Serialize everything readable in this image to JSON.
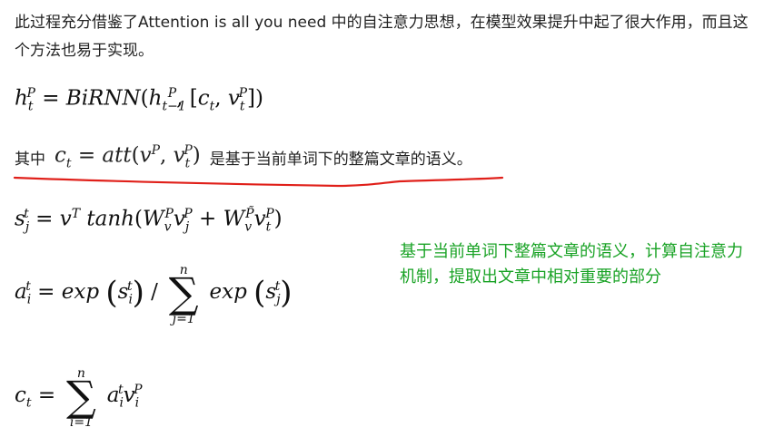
{
  "intro": {
    "text": "此过程充分借鉴了Attention is all you need 中的自注意力思想，在模型效果提升中起了很大作用，而且这个方法也易于实现。"
  },
  "formula_1": "h_t^P = BiRNN(h_{t-1}^P, [c_t, v_t^P])",
  "line_2": {
    "prefix": "其中",
    "formula": "c_t = att(v^P, v_t^P)",
    "suffix": "是基于当前单词下的整篇文章的语义。"
  },
  "formula_2": "s_j^t = v^T tanh(W_v^P v_j^P + W_v^{P~} v_t^P)",
  "formula_3": "a_i^t = exp(s_i^t) / sum_{j=1}^{n} exp(s_j^t)",
  "formula_4": "c_t = sum_{i=1}^{n} a_i^t v_i^P",
  "note": {
    "text": "基于当前单词下整篇文章的语义，计算自注意力机制，提取出文章中相对重要的部分",
    "color": "#1aa326"
  },
  "annotation": {
    "underline_color": "#e0201a"
  }
}
